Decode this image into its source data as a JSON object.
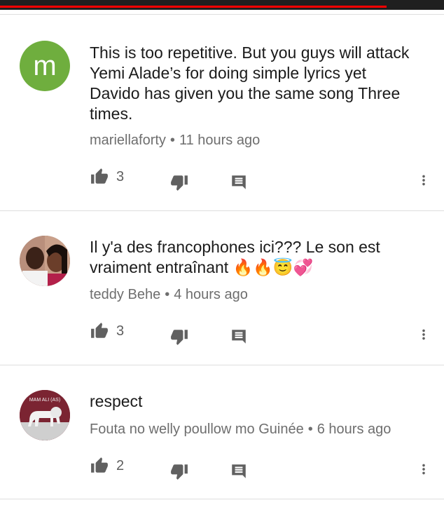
{
  "comments": [
    {
      "avatar_letter": "m",
      "text": "This is too repetitive. But you guys will attack Yemi Alade’s for doing simple lyrics yet Davido has given you the same song Three times.",
      "author": "mariellaforty",
      "time": "11 hours ago",
      "likes": "3"
    },
    {
      "text": "Il y'a des francophones ici??? Le son est vraiment entraînant 🔥🔥😇💞",
      "author": "teddy Behe",
      "time": "4 hours ago",
      "likes": "3"
    },
    {
      "avatar_caption": "MAM ALI (AS)",
      "text": "respect",
      "author": "Fouta no welly poullow mo Guinée",
      "time": "6 hours ago",
      "likes": "2"
    }
  ],
  "separator": "•",
  "colors": {
    "topbar": "#1f1f1f",
    "progress": "#ff0000",
    "avatar_m": "#6fae3e",
    "icon": "#606060",
    "meta_text": "#6e6e6e"
  },
  "video_progress_fraction": 0.87,
  "icons": [
    "thumb-up-icon",
    "thumb-down-icon",
    "reply-icon",
    "more-vert-icon"
  ]
}
